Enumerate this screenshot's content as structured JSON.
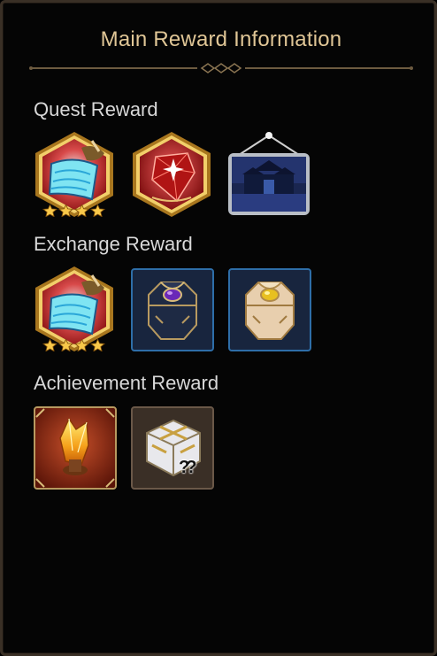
{
  "header": {
    "title": "Main Reward Information"
  },
  "sections": {
    "quest": {
      "label": "Quest Reward"
    },
    "exchange": {
      "label": "Exchange Reward"
    },
    "achievement": {
      "label": "Achievement Reward"
    }
  },
  "items": {
    "quest_scroll": {
      "icon": "skill-scroll-icon",
      "stars": 4
    },
    "quest_gem": {
      "icon": "red-gem-icon"
    },
    "quest_frame": {
      "icon": "night-palace-picture-icon"
    },
    "exchange_scroll": {
      "icon": "skill-scroll-icon",
      "stars": 4
    },
    "exchange_chest_purple": {
      "icon": "purple-gem-chest-icon"
    },
    "exchange_chest_gold": {
      "icon": "gold-gem-chest-icon"
    },
    "achievement_crystal": {
      "icon": "fire-crystal-icon"
    },
    "achievement_box": {
      "icon": "mystery-box-icon",
      "mark": "??"
    }
  },
  "colors": {
    "title": "#e0c696",
    "section_text": "#d8d8d8",
    "hex_gold": "#d8a23c",
    "blue_border": "#2e6ea8"
  }
}
